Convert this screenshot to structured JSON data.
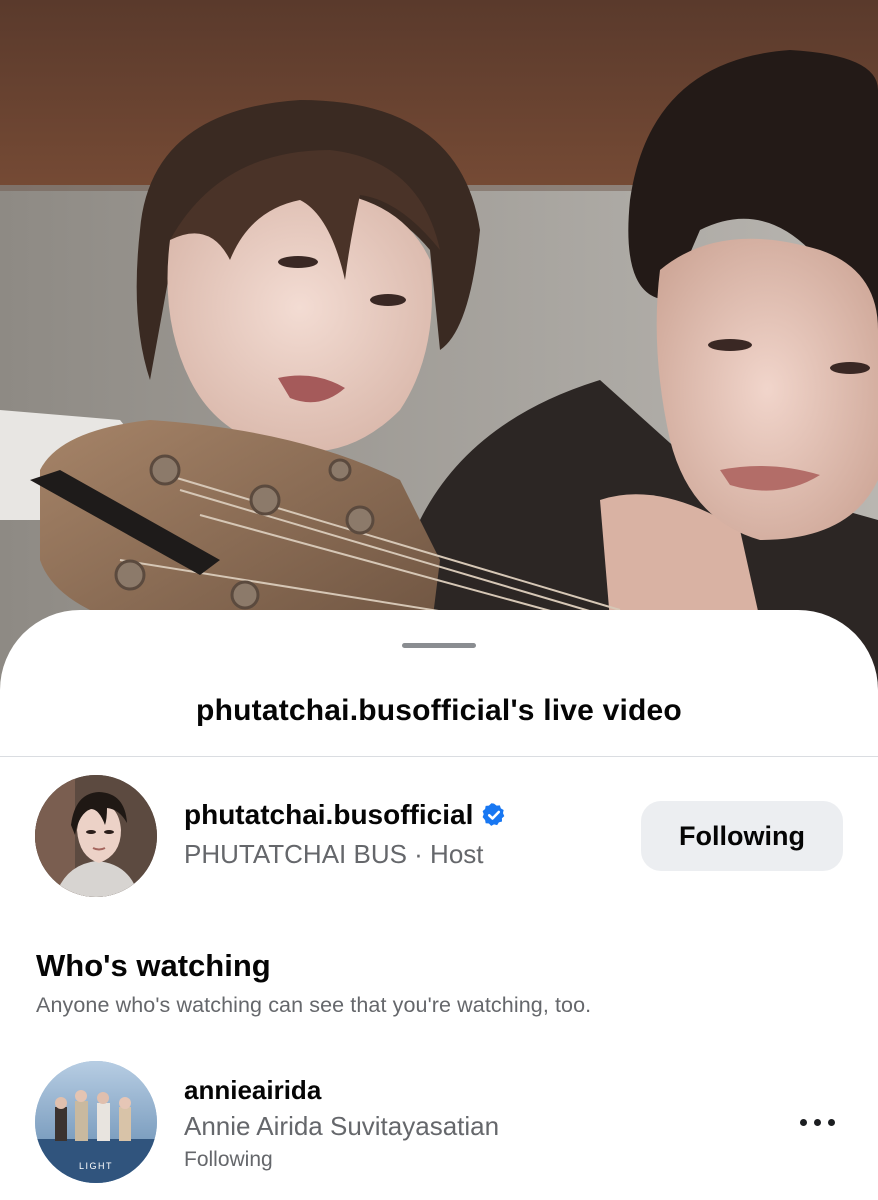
{
  "sheet": {
    "title": "phutatchai.busofficial's live video"
  },
  "host": {
    "username": "phutatchai.busofficial",
    "display_line": "PHUTATCHAI BUS · Host",
    "verified": true,
    "follow_button_label": "Following"
  },
  "watching": {
    "heading": "Who's watching",
    "note": "Anyone who's watching can see that you're watching, too.",
    "viewers": [
      {
        "username": "annieairida",
        "full_name": "Annie Airida Suvitayasatian",
        "status": "Following",
        "avatar_text": "LIGHT"
      }
    ]
  },
  "icons": {
    "verified": "verified-badge-icon",
    "more": "more-options-icon"
  },
  "colors": {
    "verified_blue": "#1877f2",
    "secondary_text": "#65676b",
    "button_bg": "#eceef1"
  }
}
